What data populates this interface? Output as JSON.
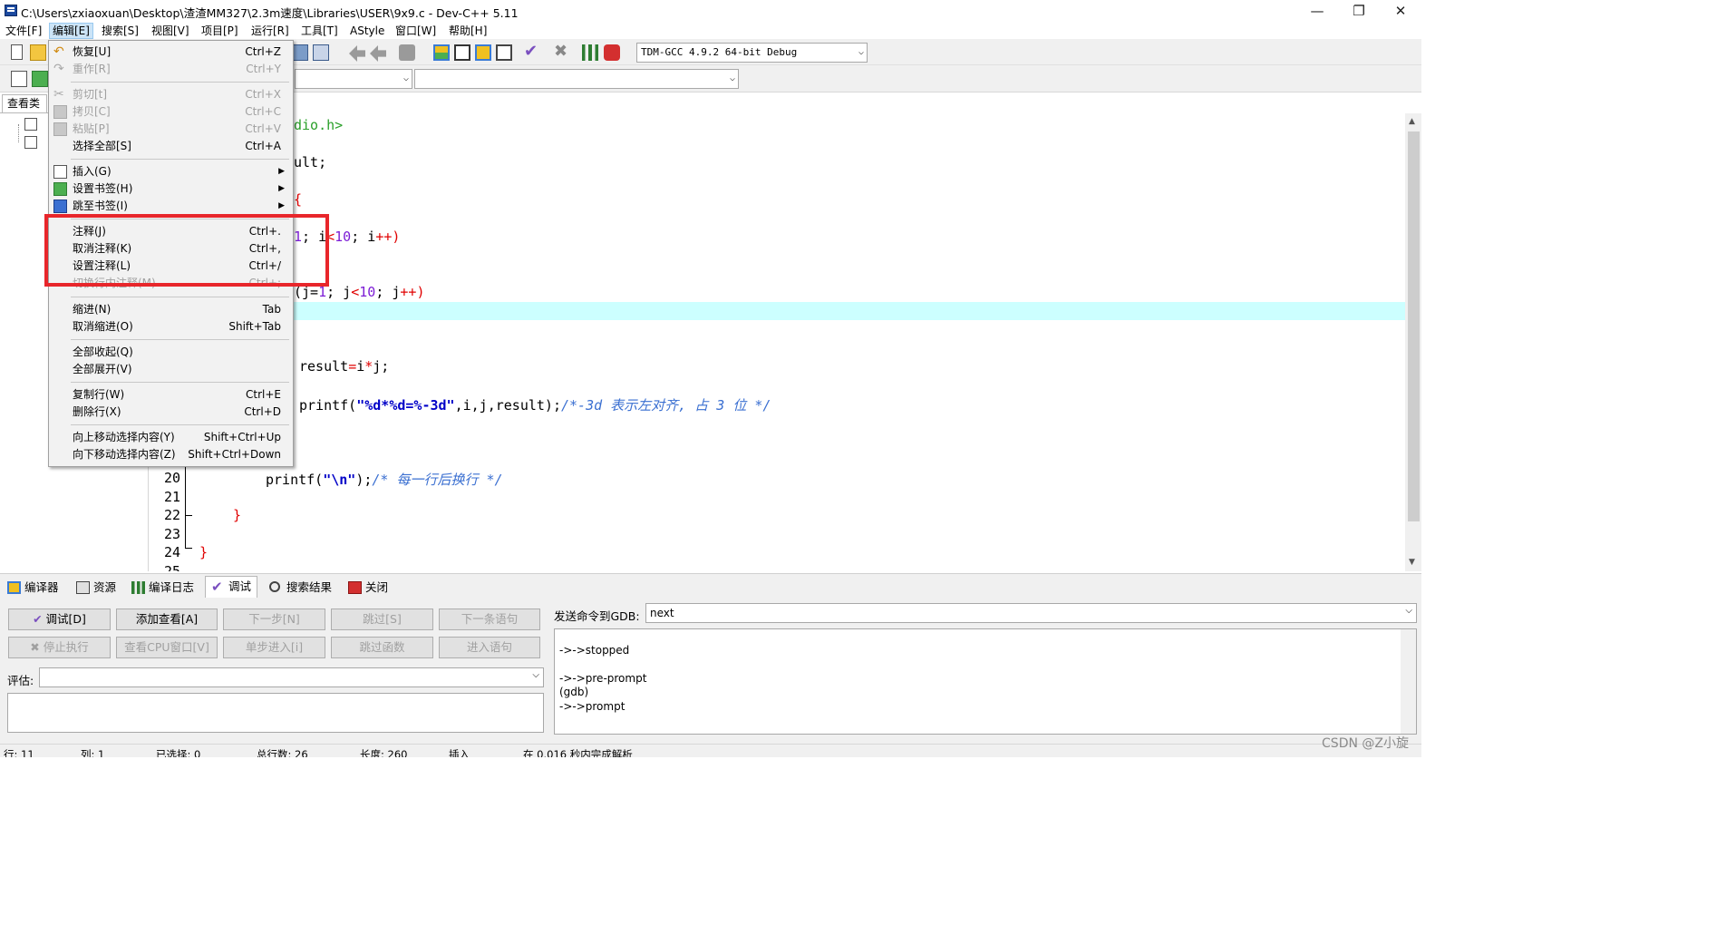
{
  "window": {
    "title": "C:\\Users\\zxiaoxuan\\Desktop\\渣渣MM327\\2.3m速度\\Libraries\\USER\\9x9.c - Dev-C++ 5.11"
  },
  "menubar": {
    "items": [
      "文件[F]",
      "编辑[E]",
      "搜索[S]",
      "视图[V]",
      "项目[P]",
      "运行[R]",
      "工具[T]",
      "AStyle",
      "窗口[W]",
      "帮助[H]"
    ]
  },
  "toolbar": {
    "compiler": "TDM-GCC 4.9.2 64-bit Debug"
  },
  "left_panel": {
    "tab": "查看类"
  },
  "edit_menu": {
    "items": [
      {
        "label": "恢复[U]",
        "shortcut": "Ctrl+Z"
      },
      {
        "label": "重作[R]",
        "shortcut": "Ctrl+Y"
      },
      {
        "label": "剪切[t]",
        "shortcut": "Ctrl+X"
      },
      {
        "label": "拷贝[C]",
        "shortcut": "Ctrl+C"
      },
      {
        "label": "粘贴[P]",
        "shortcut": "Ctrl+V"
      },
      {
        "label": "选择全部[S]",
        "shortcut": "Ctrl+A"
      },
      {
        "label": "插入(G)",
        "shortcut": ""
      },
      {
        "label": "设置书签(H)",
        "shortcut": ""
      },
      {
        "label": "跳至书签(I)",
        "shortcut": ""
      },
      {
        "label": "注释(J)",
        "shortcut": "Ctrl+."
      },
      {
        "label": "取消注释(K)",
        "shortcut": "Ctrl+,"
      },
      {
        "label": "设置注释(L)",
        "shortcut": "Ctrl+/"
      },
      {
        "label": "切换行内注释(M)",
        "shortcut": "Ctrl+;"
      },
      {
        "label": "缩进(N)",
        "shortcut": "Tab"
      },
      {
        "label": "取消缩进(O)",
        "shortcut": "Shift+Tab"
      },
      {
        "label": "全部收起(Q)",
        "shortcut": ""
      },
      {
        "label": "全部展开(V)",
        "shortcut": ""
      },
      {
        "label": "复制行(W)",
        "shortcut": "Ctrl+E"
      },
      {
        "label": "删除行(X)",
        "shortcut": "Ctrl+D"
      },
      {
        "label": "向上移动选择内容(Y)",
        "shortcut": "Shift+Ctrl+Up"
      },
      {
        "label": "向下移动选择内容(Z)",
        "shortcut": "Shift+Ctrl+Down"
      }
    ]
  },
  "editor": {
    "line_numbers": [
      "20",
      "21",
      "22",
      "23",
      "24",
      "25"
    ],
    "code": {
      "l1": "dio.h>",
      "l2": "ult;",
      "l3": "{",
      "l4a": "1",
      "l4b": "; i",
      "l4c": "10",
      "l4d": "; i",
      "l4e": "++",
      "l5a": "(j=",
      "l5b": "1",
      "l5c": "; j",
      "l5d": "10",
      "l5e": "; j",
      "l5f": "++",
      "l6a": "result",
      "l6b": "=",
      "l6c": "i",
      "l6d": "*",
      "l6e": "j;",
      "l7a": "printf(",
      "l7b": "\"%d*%d=%-3d\"",
      "l7c": ",i,j,result);",
      "l7d": "/*-3d 表示左对齐, 占 3 位 */",
      "l8a": "printf(",
      "l8b": "\"\\n\"",
      "l8c": ");",
      "l8d": "/* 每一行后换行 */",
      "l9": "}",
      "l10": "}"
    }
  },
  "bottom_tabs": [
    "编译器",
    "资源",
    "编译日志",
    "调试",
    "搜索结果",
    "关闭"
  ],
  "debug": {
    "buttons_row1": [
      "调试[D]",
      "添加查看[A]",
      "下一步[N]",
      "跳过[S]",
      "下一条语句"
    ],
    "buttons_row2": [
      "停止执行",
      "查看CPU窗口[V]",
      "单步进入[i]",
      "跳过函数",
      "进入语句"
    ],
    "eval_label": "评估:",
    "gdb_label": "发送命令到GDB:",
    "gdb_value": "next",
    "output": [
      "->->stopped",
      "",
      "->->pre-prompt",
      "(gdb)",
      "->->prompt"
    ]
  },
  "statusbar": {
    "items": [
      "行: 11",
      "列: 1",
      "已选择: 0",
      "总行数: 26",
      "长度: 260",
      "插入",
      "在 0.016 秒内完成解析"
    ]
  },
  "watermark": "CSDN @Z小旋"
}
